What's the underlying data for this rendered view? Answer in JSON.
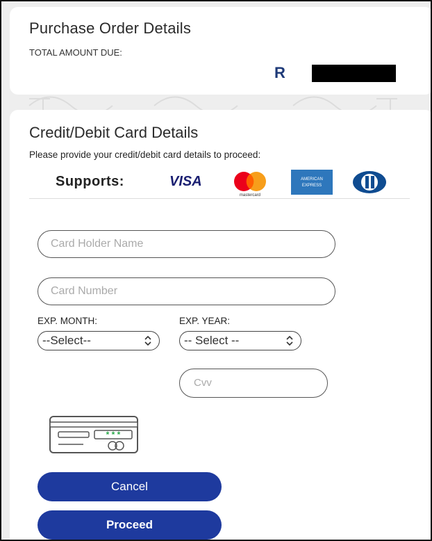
{
  "purchase_order": {
    "title": "Purchase Order Details",
    "amount_label": "TOTAL AMOUNT DUE:",
    "currency_symbol": "R"
  },
  "card_details": {
    "title": "Credit/Debit Card Details",
    "subtitle": "Please provide your credit/debit card details to proceed:",
    "supports_label": "Supports:",
    "brands": [
      "VISA",
      "mastercard",
      "AMERICAN EXPRESS",
      "Diners Club"
    ]
  },
  "form": {
    "card_holder_placeholder": "Card Holder Name",
    "card_number_placeholder": "Card Number",
    "exp_month_label": "EXP. MONTH:",
    "exp_year_label": "EXP. YEAR:",
    "exp_month_value": "--Select--",
    "exp_year_value": "-- Select --",
    "cvv_placeholder": "Cvv"
  },
  "buttons": {
    "cancel": "Cancel",
    "proceed": "Proceed"
  },
  "colors": {
    "button_bg": "#1e3a9e",
    "currency": "#1e3a78",
    "visa": "#1a1f71",
    "amex": "#2e77bc"
  }
}
